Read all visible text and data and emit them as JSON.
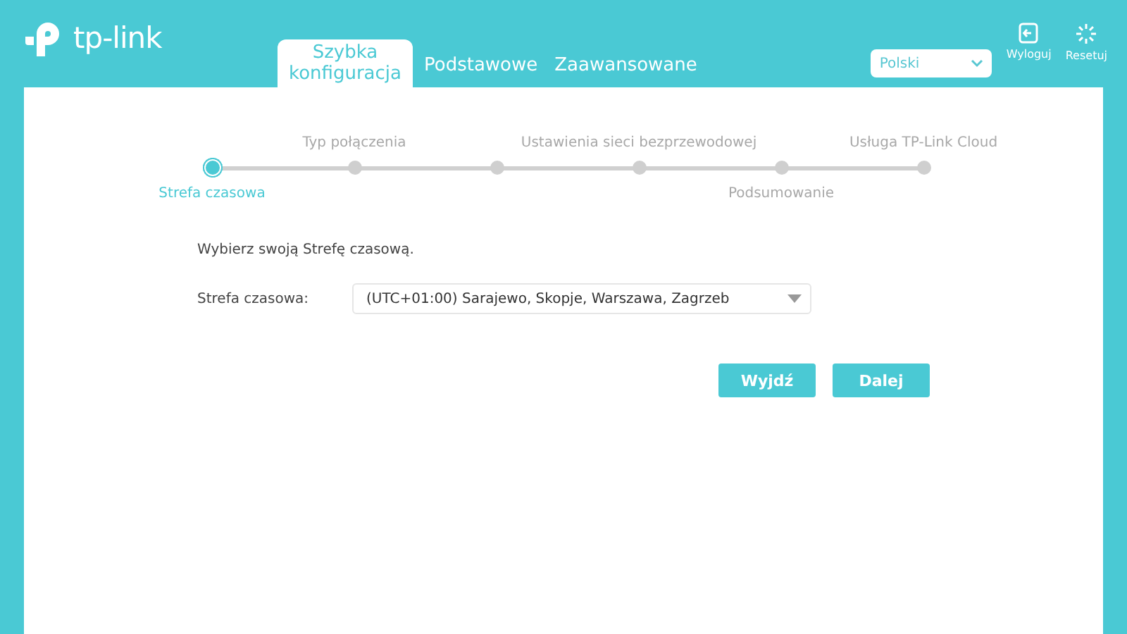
{
  "header": {
    "logo_text": "tp-link",
    "tabs": [
      {
        "label": "Szybka konfiguracja",
        "selected": true
      },
      {
        "label": "Podstawowe",
        "selected": false
      },
      {
        "label": "Zaawansowane",
        "selected": false
      }
    ],
    "language": {
      "value": "Polski"
    },
    "actions": [
      {
        "kind": "logout",
        "label": "Wyloguj"
      },
      {
        "kind": "reset",
        "label": "Resetuj"
      }
    ]
  },
  "stepper": {
    "steps": [
      {
        "label": "Strefa czasowa",
        "kind": "below",
        "selected": true
      },
      {
        "label": "Typ połączenia",
        "kind": "above",
        "selected": false
      },
      {
        "selected": false
      },
      {
        "label": "Ustawienia sieci bezprzewodowej",
        "kind": "above",
        "selected": false
      },
      {
        "label": "Podsumowanie",
        "kind": "below",
        "selected": false
      },
      {
        "label": "Usługa TP-Link Cloud",
        "kind": "above",
        "selected": false
      }
    ]
  },
  "form": {
    "instruction": "Wybierz swoją Strefę czasową.",
    "field_label": "Strefa czasowa:",
    "timezone": {
      "value": "(UTC+01:00) Sarajewo, Skopje, Warszawa, Zagrzeb"
    }
  },
  "buttons": [
    "Wyjdź",
    "Dalej"
  ]
}
